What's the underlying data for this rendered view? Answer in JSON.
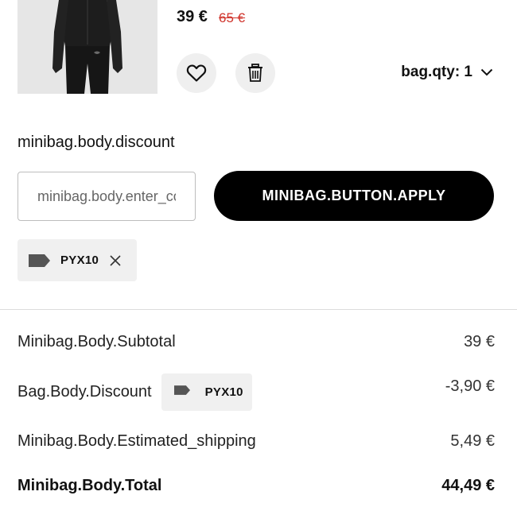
{
  "product": {
    "price_current": "39 €",
    "price_old": "65 €",
    "qty_label": "bag.qty: 1"
  },
  "discount": {
    "title": "minibag.body.discount",
    "input_placeholder": "minibag.body.enter_code",
    "apply_label": "MINIBAG.BUTTON.APPLY",
    "applied_code": "PYX10"
  },
  "summary": {
    "subtotal_label": "Minibag.Body.Subtotal",
    "subtotal_value": "39 €",
    "discount_label": "Bag.Body.Discount",
    "discount_code": "PYX10",
    "discount_value": "-3,90 €",
    "shipping_label": "Minibag.Body.Estimated_shipping",
    "shipping_value": "5,49 €",
    "total_label": "Minibag.Body.Total",
    "total_value": "44,49 €"
  },
  "icons": {
    "wishlist": "heart-icon",
    "delete": "trash-icon",
    "qty_dropdown": "chevron-down-icon",
    "tag": "tag-icon",
    "remove": "close-icon"
  },
  "colors": {
    "accent": "#000000",
    "old_price": "#d0342c",
    "chip_bg": "#f0f0f0"
  }
}
